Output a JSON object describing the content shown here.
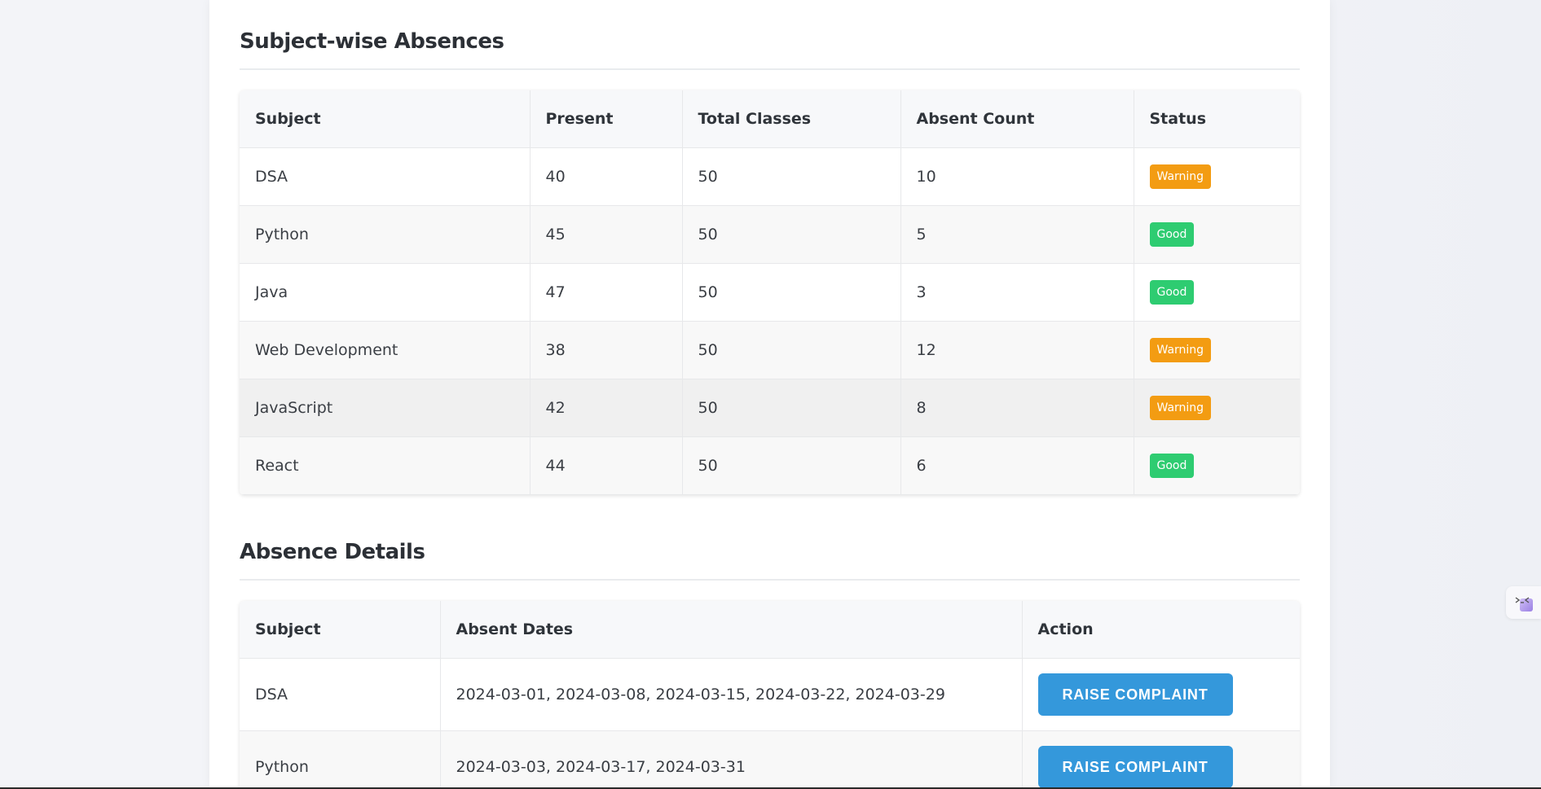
{
  "subject_section": {
    "title": "Subject-wise Absences",
    "headers": [
      "Subject",
      "Present",
      "Total Classes",
      "Absent Count",
      "Status"
    ],
    "rows": [
      {
        "subject": "DSA",
        "present": "40",
        "total": "50",
        "absent": "10",
        "status": "Warning"
      },
      {
        "subject": "Python",
        "present": "45",
        "total": "50",
        "absent": "5",
        "status": "Good"
      },
      {
        "subject": "Java",
        "present": "47",
        "total": "50",
        "absent": "3",
        "status": "Good"
      },
      {
        "subject": "Web Development",
        "present": "38",
        "total": "50",
        "absent": "12",
        "status": "Warning"
      },
      {
        "subject": "JavaScript",
        "present": "42",
        "total": "50",
        "absent": "8",
        "status": "Warning"
      },
      {
        "subject": "React",
        "present": "44",
        "total": "50",
        "absent": "6",
        "status": "Good"
      }
    ]
  },
  "details_section": {
    "title": "Absence Details",
    "headers": [
      "Subject",
      "Absent Dates",
      "Action"
    ],
    "rows": [
      {
        "subject": "DSA",
        "dates": "2024-03-01, 2024-03-08, 2024-03-15, 2024-03-22, 2024-03-29",
        "action": "RAISE COMPLAINT"
      },
      {
        "subject": "Python",
        "dates": "2024-03-03, 2024-03-17, 2024-03-31",
        "action": "RAISE COMPLAINT"
      }
    ]
  },
  "colors": {
    "warning": "#f39c12",
    "good": "#2ecc71",
    "button": "#3498db"
  },
  "icons": {
    "side_widget": "assistant-icon"
  }
}
